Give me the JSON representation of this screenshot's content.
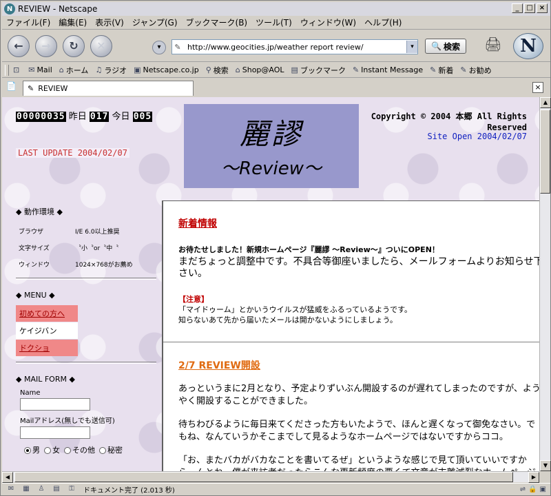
{
  "window": {
    "title": "REVIEW - Netscape"
  },
  "menu": [
    "ファイル(F)",
    "編集(E)",
    "表示(V)",
    "ジャンプ(G)",
    "ブックマーク(B)",
    "ツール(T)",
    "ウィンドウ(W)",
    "ヘルプ(H)"
  ],
  "nav": {
    "url": "http://www.geocities.jp/weather report review/",
    "search_label": "検索"
  },
  "personal_toolbar": [
    {
      "icon": "mail-icon",
      "label": "Mail"
    },
    {
      "icon": "home-icon",
      "label": "ホーム"
    },
    {
      "icon": "radio-icon",
      "label": "ラジオ"
    },
    {
      "icon": "my-icon",
      "label": "Netscape.co.jp"
    },
    {
      "icon": "search-icon",
      "label": "検索"
    },
    {
      "icon": "shop-icon",
      "label": "Shop@AOL"
    },
    {
      "icon": "folder-icon",
      "label": "ブックマーク"
    },
    {
      "icon": "bookmark-icon",
      "label": "Instant Message"
    },
    {
      "icon": "bookmark-icon",
      "label": "新着"
    },
    {
      "icon": "bookmark-icon",
      "label": "お勧め"
    }
  ],
  "tab": {
    "label": "REVIEW"
  },
  "header": {
    "counter_total": "00000035",
    "yesterday_label": "昨日",
    "yesterday_count": "017",
    "today_label": "今日",
    "today_count": "005",
    "last_update": "LAST UPDATE 2004/02/07",
    "banner_title": "麗謬",
    "banner_subtitle": "〜Review〜",
    "copyright": "Copyright © 2004 本郷 All Rights Reserved",
    "site_open": "Site Open 2004/02/07"
  },
  "sidebar": {
    "env_title": "◆ 動作環境 ◆",
    "env": [
      {
        "k": "ブラウザ",
        "v": "I/E 6.0以上推奨"
      },
      {
        "k": "文字サイズ",
        "v": "〝小〝or〝中〝"
      },
      {
        "k": "ウィンドウ",
        "v": "1024×768がお薦め"
      }
    ],
    "menu_title": "◆ MENU ◆",
    "menu": [
      "初めての方へ",
      "ケイジバン",
      "ドクショ"
    ],
    "mailform_title": "◆ MAIL FORM ◆",
    "name_label": "Name",
    "mail_label": "Mailアドレス(無しでも送信可)",
    "gender": [
      "男",
      "女",
      "その他",
      "秘密"
    ]
  },
  "main": {
    "news_title": "新着情報",
    "news_lead": "お待たせしました！新規ホームページ『麗謬 〜Review〜』ついにOPEN！",
    "news_body": "まだちょっと調整中です。不具合等御座いましたら、メールフォームよりお知らせ下さい。",
    "notice_title": "【注意】",
    "notice_line1": "「マイドゥーム」とかいうウイルスが猛威をふるっているようです。",
    "notice_line2": "知らないあて先から届いたメールは開かないようにしましょう。",
    "article_title": "2/7 REVIEW開設",
    "p1": "あっというまに2月となり、予定よりずいぶん開設するのが遅れてしまったのですが、ようやく開設することができました。",
    "p2": "待ちわびるように毎日来てくださった方もいたようで、ほんと遅くなって御免なさい。でもね、なんていうかそこまでして見るようなホームページではないですからココ。",
    "p3": "「お、またバカがバカなことを書いてるぜ」というような感じで見て頂いていいですから。んとね、僕が来訪者だったらこんな更新頻度の悪くて文章が支離滅裂なホームページは"
  },
  "status": {
    "text": "ドキュメント完了 (2.013 秒)"
  }
}
